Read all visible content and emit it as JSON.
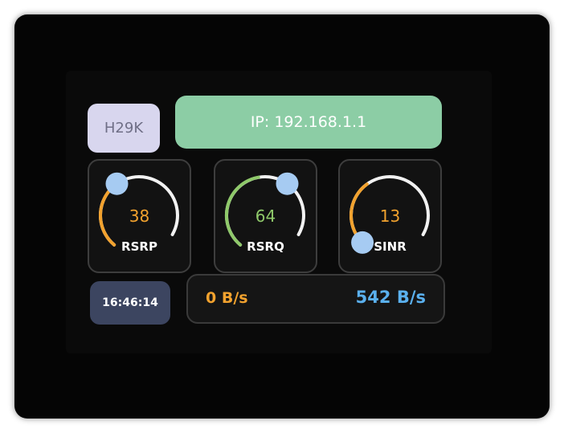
{
  "device": {
    "model": "H29K"
  },
  "network": {
    "ip_text": "IP: 192.168.1.1"
  },
  "gauges": [
    {
      "value": "38",
      "label": "RSRP",
      "value_color": "#f2a22e",
      "arc_color": "#f2a22e"
    },
    {
      "value": "64",
      "label": "RSRQ",
      "value_color": "#8fc96a",
      "arc_color": "#8fc96a"
    },
    {
      "value": "13",
      "label": "SINR",
      "value_color": "#f2a22e",
      "arc_color": "#f2a22e"
    }
  ],
  "status": {
    "time": "16:46:14"
  },
  "traffic": {
    "download": "0 B/s",
    "upload": "542 B/s"
  },
  "colors": {
    "knob": "#a6cbf2",
    "track": "#f2f2f2",
    "ip_background": "#8ccda5",
    "device_background": "#d8d6ee",
    "time_background": "#3c4560"
  }
}
